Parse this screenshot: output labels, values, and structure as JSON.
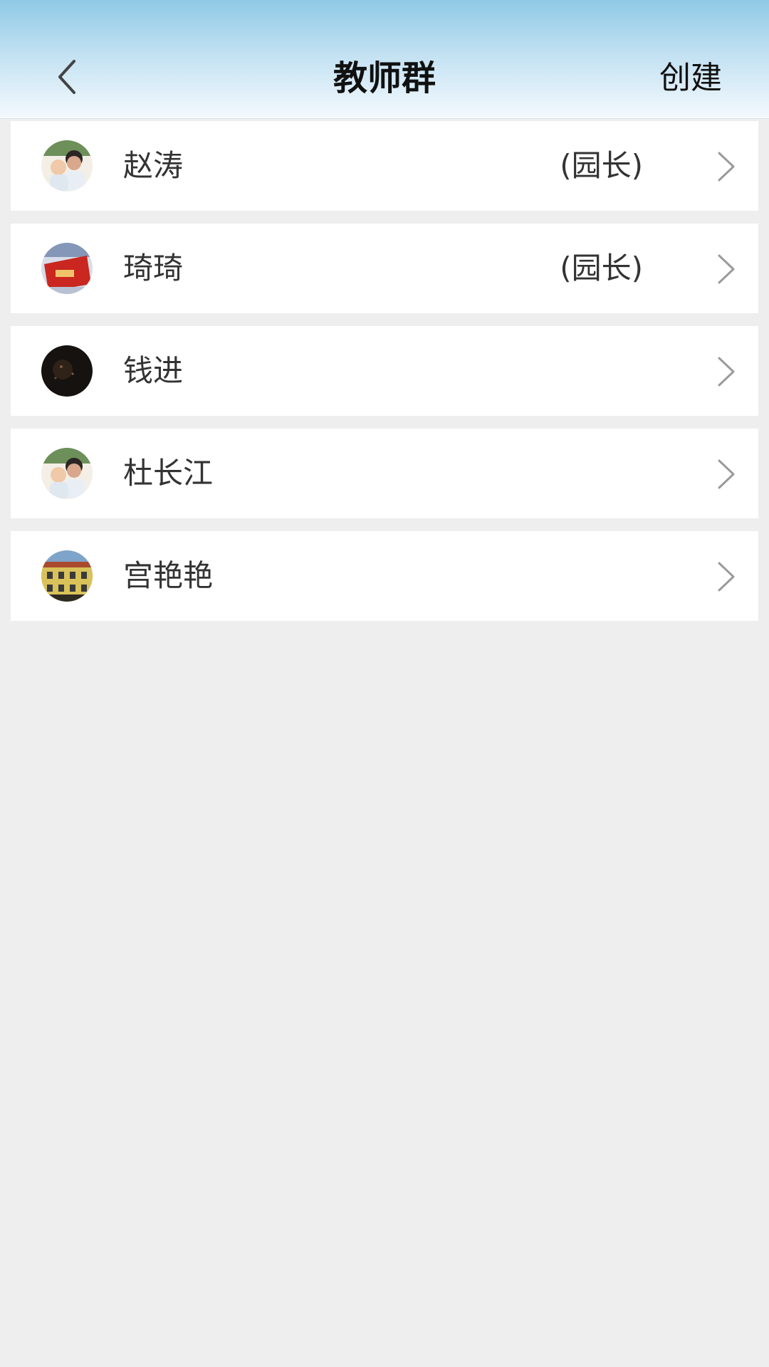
{
  "header": {
    "title": "教师群",
    "create_label": "创建",
    "back_icon": "chevron-left-icon"
  },
  "members": [
    {
      "name": "赵涛",
      "role": "(园长)",
      "avatar": "family-photo-avatar"
    },
    {
      "name": "琦琦",
      "role": "(园长)",
      "avatar": "red-card-avatar"
    },
    {
      "name": "钱进",
      "role": "",
      "avatar": "dark-night-avatar"
    },
    {
      "name": "杜长江",
      "role": "",
      "avatar": "family-photo-avatar"
    },
    {
      "name": "宫艳艳",
      "role": "",
      "avatar": "building-avatar"
    }
  ],
  "colors": {
    "header_top": "#8fc9e6",
    "background": "#eeeeee",
    "row_background": "#ffffff"
  }
}
